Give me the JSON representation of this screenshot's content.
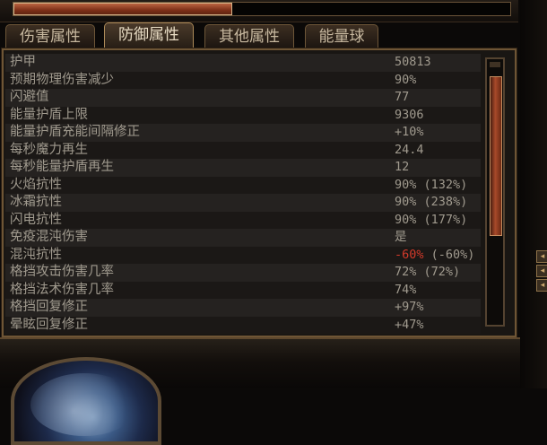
{
  "top_bar": {
    "progress_fraction": 0.44
  },
  "tabs": [
    {
      "label": "伤害属性",
      "active": false
    },
    {
      "label": "防御属性",
      "active": true
    },
    {
      "label": "其他属性",
      "active": false
    },
    {
      "label": "能量球",
      "active": false
    }
  ],
  "stats": [
    {
      "label": "护甲",
      "value": "50813"
    },
    {
      "label": "预期物理伤害减少",
      "value": "90%"
    },
    {
      "label": "闪避值",
      "value": "77"
    },
    {
      "label": "能量护盾上限",
      "value": "9306"
    },
    {
      "label": "能量护盾充能间隔修正",
      "value": "+10%"
    },
    {
      "label": "每秒魔力再生",
      "value": "24.4"
    },
    {
      "label": "每秒能量护盾再生",
      "value": "12"
    },
    {
      "label": "火焰抗性",
      "value": "90% (132%)"
    },
    {
      "label": "冰霜抗性",
      "value": "90% (238%)"
    },
    {
      "label": "闪电抗性",
      "value": "90% (177%)"
    },
    {
      "label": "免疫混沌伤害",
      "value": "是"
    },
    {
      "label": "混沌抗性",
      "value_negative": "-60%",
      "value": " (-60%)"
    },
    {
      "label": "格挡攻击伤害几率",
      "value": "72% (72%)"
    },
    {
      "label": "格挡法术伤害几率",
      "value": "74%"
    },
    {
      "label": "格挡回复修正",
      "value": "+97%"
    },
    {
      "label": "晕眩回复修正",
      "value": "+47%"
    }
  ],
  "scrollbar": {
    "thumb_start_fraction": 0.03,
    "thumb_size_fraction": 0.62
  },
  "colors": {
    "text": "#a09a8e",
    "negative": "#d23a2a",
    "frame_gold": "#6e5535",
    "scroll_thumb": "#a8492a"
  },
  "icons": [
    "scroll-up-arrow-icon",
    "side-menu-icon",
    "side-menu-icon",
    "side-menu-icon"
  ]
}
